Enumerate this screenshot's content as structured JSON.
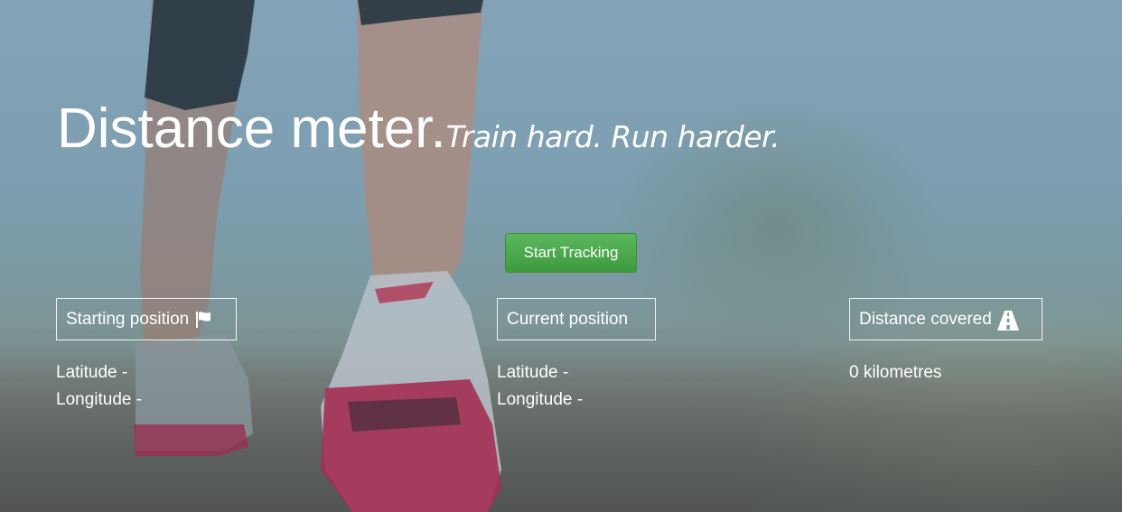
{
  "hero": {
    "title": "Distance meter.",
    "tagline": "Train hard. Run harder."
  },
  "actions": {
    "start_label": "Start Tracking"
  },
  "starting_position": {
    "label": "Starting position",
    "icon": "flag-icon",
    "latitude": "Latitude -",
    "longitude": "Longitude -"
  },
  "current_position": {
    "label": "Current position",
    "latitude": "Latitude -",
    "longitude": "Longitude -"
  },
  "distance": {
    "label": "Distance covered",
    "icon": "road-icon",
    "value": "0 kilometres"
  },
  "colors": {
    "button_green": "#4cae4c",
    "text": "#ffffff"
  }
}
